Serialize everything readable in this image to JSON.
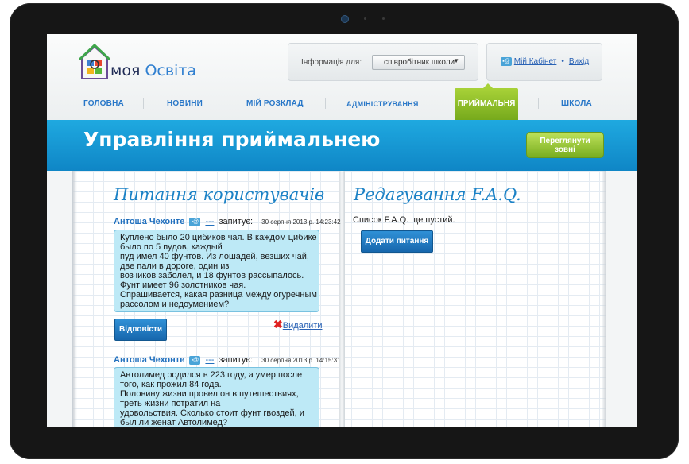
{
  "brand": {
    "name_part1": "моя ",
    "name_part2": "Освіта"
  },
  "info": {
    "label": "Інформація для:",
    "role_selected": "співробітник школи"
  },
  "user": {
    "cabinet": "Мій Кабінет",
    "logout": "Вихід",
    "separator": "•"
  },
  "nav": {
    "items": [
      "ГОЛОВНА",
      "НОВИНИ",
      "МІЙ РОЗКЛАД",
      "АДМІНІСТРУВАННЯ",
      "ПРИЙМАЛЬНЯ",
      "ШКОЛА"
    ],
    "active": "ПРИЙМАЛЬНЯ"
  },
  "banner": {
    "title": "Управління приймальнею",
    "view_button": [
      "Переглянути",
      "зовні"
    ]
  },
  "questions": {
    "title": "Питання користувачів",
    "items": [
      {
        "author": "Антоша Чехонте",
        "dash": "---",
        "asked": "запитує:",
        "date": "30 серпня 2013 р. 14:23:42",
        "lines": [
          "Куплено было 20 цибиков чая. В каждом цибике",
          "было по 5 пудов, каждый",
          "пуд имел 40 фунтов. Из лошадей, везших чай,",
          "две пали в дороге, один из",
          "возчиков заболел, и 18 фунтов рассыпалось.",
          "Фунт имеет 96 золотников чая.",
          "Спрашивается, какая разница между огуречным",
          "рассолом и недоумением?"
        ]
      },
      {
        "author": "Антоша Чехонте",
        "dash": "---",
        "asked": "запитує:",
        "date": "30 серпня 2013 р. 14:15:31",
        "lines": [
          "Автолимед родился в 223 году, а умер после",
          "того, как прожил 84 года.",
          "Половину жизни провел он в путешествиях,",
          "треть жизни потратил на",
          "удовольствия. Сколько стоит фунт гвоздей, и",
          "был ли женат Автолимед?"
        ]
      }
    ],
    "reply_label": "Відповісти",
    "delete_label": "Видалити"
  },
  "faq": {
    "title": "Редагування F.A.Q.",
    "empty_text": "Список F.A.Q. ще пустий.",
    "add_label": "Додати питання"
  },
  "colors": {
    "accent_blue": "#1c82c6",
    "banner_blue": "#14a0dc",
    "active_green": "#8fbf2a",
    "bubble": "#bde9f6"
  }
}
